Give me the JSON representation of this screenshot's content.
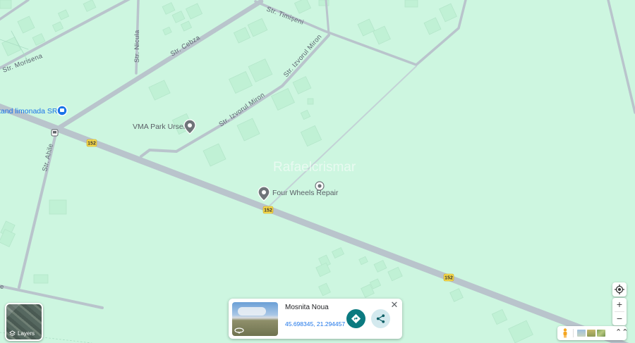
{
  "map": {
    "streets": {
      "morisena": "Str. Morisena",
      "cebza": "Str. Cebza",
      "nicula": "Str. Nicula",
      "timiseni": "Str. Timișeni",
      "izvorul_miron_1": "Str. Izvorul Miron",
      "izvorul_miron_2": "Str. Izvorul Miron",
      "ahile": "Str. Ahile"
    },
    "route_shields": {
      "a": "152",
      "b": "152",
      "c": "152"
    },
    "pois": {
      "limonada": "tand limonada SRL",
      "vma": "VMA Park Urseni",
      "four_wheels": "Four Wheels Repair"
    },
    "watermark": "Rafaelcrismar",
    "edge_letter": "e"
  },
  "layers": {
    "label": "Layers"
  },
  "place_card": {
    "title": "Mosnita Noua",
    "coords": "45.698345, 21.294457",
    "close": "✕"
  },
  "controls": {
    "zoom_in": "+",
    "zoom_out": "−",
    "expand": "⌃⌃"
  },
  "colors": {
    "land": "#cdf6e0",
    "road": "#b7c3cb",
    "building": "#bff0d4",
    "shield": "#f6d94a",
    "accent": "#0b7a80",
    "link": "#1a73e8"
  }
}
